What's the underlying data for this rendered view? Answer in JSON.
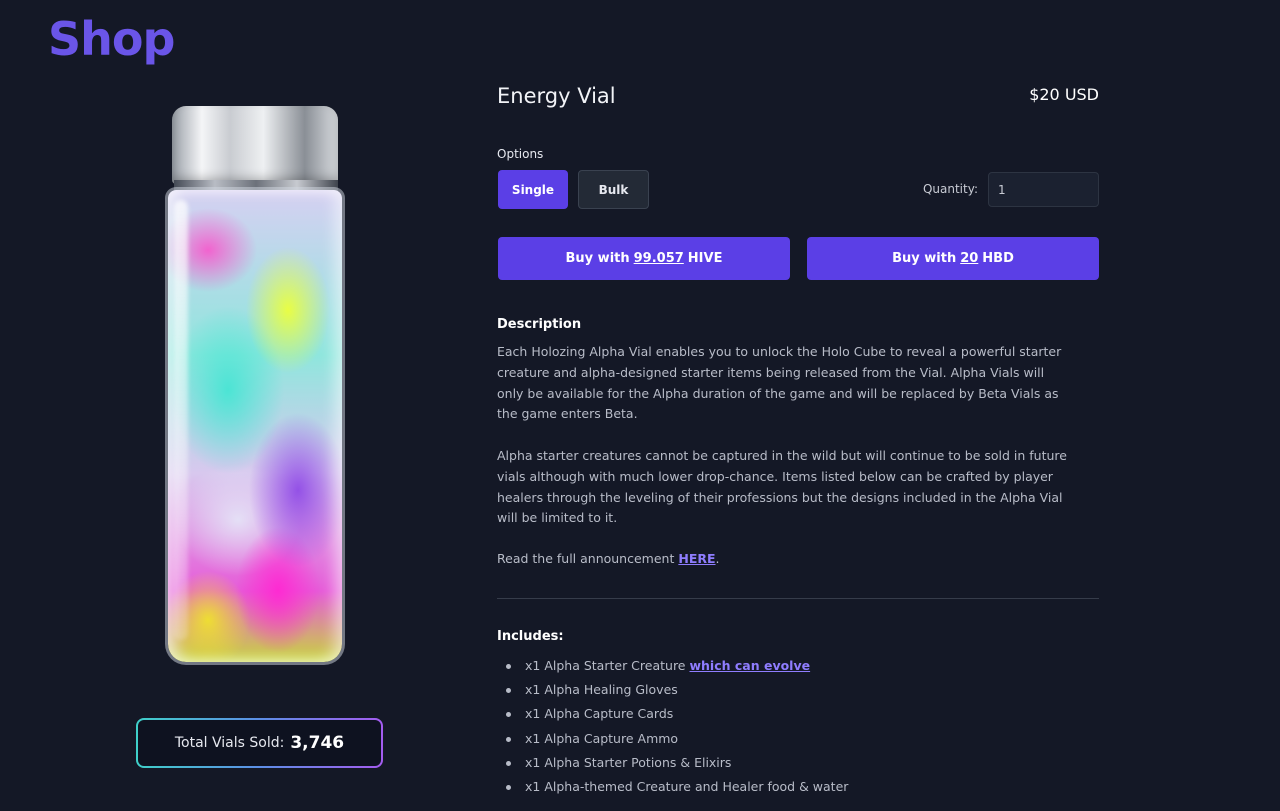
{
  "header": {
    "title": "Shop"
  },
  "product": {
    "name": "Energy Vial",
    "price": "$20 USD"
  },
  "options": {
    "label": "Options",
    "buttons": [
      "Single",
      "Bulk"
    ],
    "selected": "Single",
    "quantity_label": "Quantity:",
    "quantity_value": "1"
  },
  "buy": {
    "hive": {
      "prefix": "Buy with",
      "amount": "99.057",
      "currency": "HIVE"
    },
    "hbd": {
      "prefix": "Buy with",
      "amount": "20",
      "currency": "HBD"
    }
  },
  "description": {
    "heading": "Description",
    "p1": "Each Holozing Alpha Vial enables you to unlock the Holo Cube to reveal a powerful starter creature and alpha-designed starter items being released from the Vial. Alpha Vials will only be available for the Alpha duration of the game and will be replaced by Beta Vials as the game enters Beta.",
    "p2": "Alpha starter creatures cannot be captured in the wild but will continue to be sold in future vials although with much lower drop-chance. Items listed below can be crafted by player healers through the leveling of their professions but the designs included in the Alpha Vial will be limited to it.",
    "p3_prefix": "Read the full announcement",
    "p3_link": "HERE",
    "p3_suffix": "."
  },
  "includes": {
    "heading": "Includes:",
    "items": [
      {
        "text": "x1 Alpha Starter Creature",
        "link": "which can evolve"
      },
      {
        "text": "x1 Alpha Healing Gloves"
      },
      {
        "text": "x1 Alpha Capture Cards"
      },
      {
        "text": "x1 Alpha Capture Ammo"
      },
      {
        "text": "x1 Alpha Starter Potions & Elixirs"
      },
      {
        "text": "x1 Alpha-themed Creature and Healer food & water"
      }
    ]
  },
  "stats": {
    "sold_label": "Total Vials Sold:",
    "sold_value": "3,746"
  },
  "colors": {
    "accent": "#5b3fe6",
    "title": "#6a55e8",
    "background": "#141826",
    "link": "#8f7dff"
  }
}
